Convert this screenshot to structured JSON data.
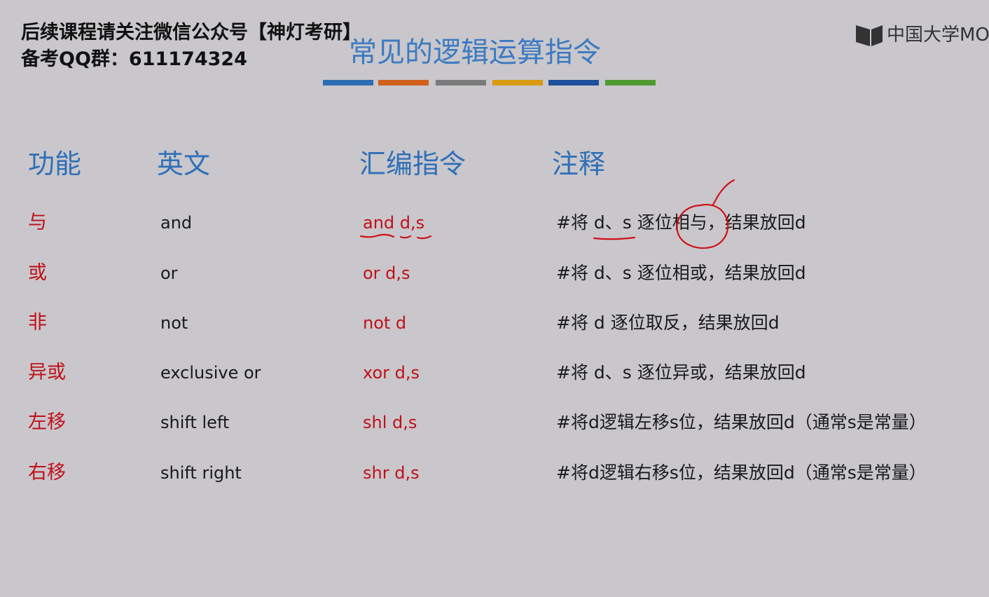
{
  "watermark": {
    "line1": "后续课程请关注微信公众号【神灯考研】",
    "line2": "备考QQ群：611174324"
  },
  "slide": {
    "title": "常见的逻辑运算指令",
    "title_bar_colors": [
      "#2e6db3",
      "#d0601c",
      "#7b7b7b",
      "#d89b12",
      "#1d4f9c",
      "#4e9a2f"
    ]
  },
  "logo": {
    "text": "中国大学MO",
    "icon": "mooc-book-icon"
  },
  "table": {
    "headers": {
      "func": "功能",
      "english": "英文",
      "asm": "汇编指令",
      "note": "注释"
    },
    "rows": [
      {
        "func": "与",
        "english": "and",
        "asm": "and d,s",
        "note": "#将 d、s 逐位相与，结果放回d"
      },
      {
        "func": "或",
        "english": "or",
        "asm": "or d,s",
        "note": "#将 d、s 逐位相或，结果放回d"
      },
      {
        "func": "非",
        "english": "not",
        "asm": "not d",
        "note": "#将 d 逐位取反，结果放回d"
      },
      {
        "func": "异或",
        "english": "exclusive or",
        "asm": "xor d,s",
        "note": "#将 d、s 逐位异或，结果放回d"
      },
      {
        "func": "左移",
        "english": "shift left",
        "asm": "shl d,s",
        "note": "#将d逻辑左移s位，结果放回d（通常s是常量）"
      },
      {
        "func": "右移",
        "english": "shift right",
        "asm": "shr d,s",
        "note": "#将d逻辑右移s位，结果放回d（通常s是常量）"
      }
    ]
  },
  "colors": {
    "background": "#c9c7cb",
    "title_blue": "#3b7ac2",
    "header_blue": "#2f6fb8",
    "accent_red": "#c0101a"
  }
}
